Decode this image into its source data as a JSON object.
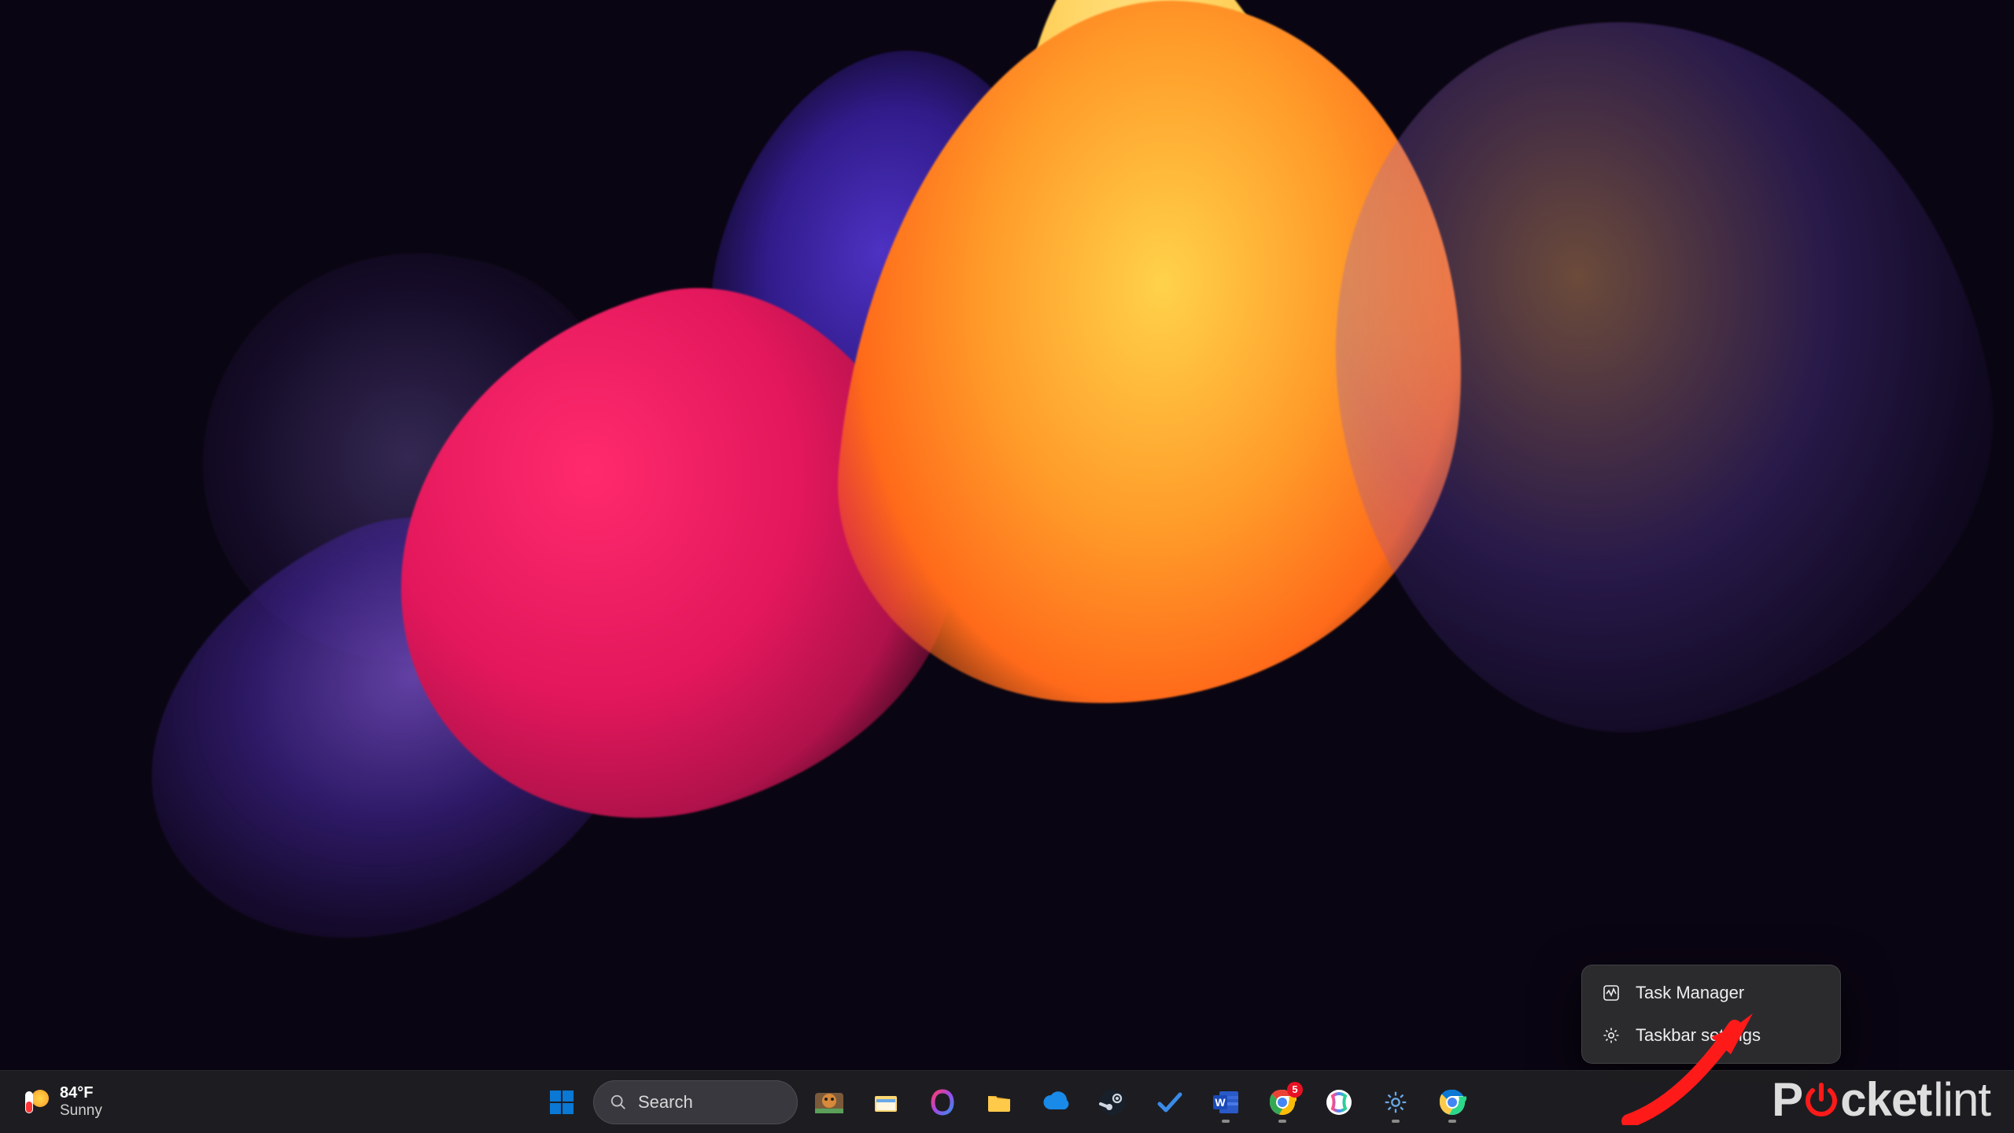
{
  "weather": {
    "temp": "84°F",
    "condition": "Sunny"
  },
  "search": {
    "placeholder": "Search"
  },
  "taskbar": {
    "apps": [
      {
        "name": "start",
        "icon": "windows-icon"
      },
      {
        "name": "task-view",
        "icon": "task-view-icon"
      },
      {
        "name": "file-explorer",
        "icon": "folder-icon"
      },
      {
        "name": "microsoft-365",
        "icon": "office-icon"
      },
      {
        "name": "file-explorer-2",
        "icon": "folder-open-icon"
      },
      {
        "name": "onedrive",
        "icon": "cloud-icon"
      },
      {
        "name": "steam",
        "icon": "steam-icon"
      },
      {
        "name": "todo",
        "icon": "check-icon"
      },
      {
        "name": "word",
        "icon": "word-icon"
      },
      {
        "name": "chrome",
        "icon": "chrome-icon",
        "badge": "5"
      },
      {
        "name": "copilot",
        "icon": "copilot-icon"
      },
      {
        "name": "settings",
        "icon": "gear-icon"
      },
      {
        "name": "chrome-canary",
        "icon": "chrome-canary-icon"
      }
    ]
  },
  "context_menu": {
    "items": [
      {
        "icon": "activity-icon",
        "label": "Task Manager"
      },
      {
        "icon": "gear-icon",
        "label": "Taskbar settings"
      }
    ]
  },
  "watermark": {
    "prefix": "P",
    "mid": "cket",
    "suffix": "lint"
  }
}
